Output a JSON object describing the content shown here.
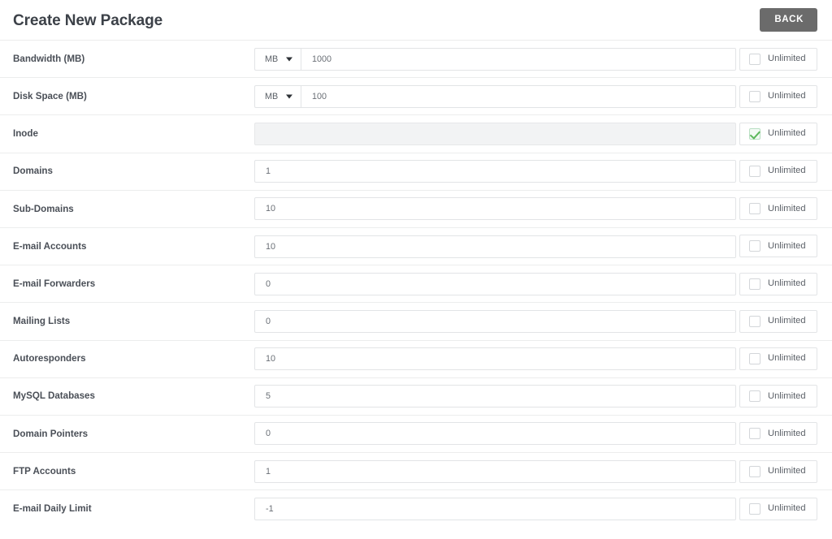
{
  "header": {
    "title": "Create New Package",
    "back_label": "BACK"
  },
  "colors": {
    "back_button_bg": "#6b6b6b",
    "check_green": "#5cb85c",
    "title_text": "#3c4148",
    "row_divider": "#eceded",
    "input_border": "#e2e4e6",
    "disabled_bg": "#f2f3f4"
  },
  "common": {
    "unlimited_label": "Unlimited",
    "caret_icon": "chevron-down-icon",
    "check_icon": "check-icon"
  },
  "rows": [
    {
      "label": "Bandwidth (MB)",
      "unit": "MB",
      "has_unit": true,
      "value": "1000",
      "disabled": false,
      "unlimited": false
    },
    {
      "label": "Disk Space (MB)",
      "unit": "MB",
      "has_unit": true,
      "value": "100",
      "disabled": false,
      "unlimited": false
    },
    {
      "label": "Inode",
      "unit": "",
      "has_unit": false,
      "value": "",
      "disabled": true,
      "unlimited": true
    },
    {
      "label": "Domains",
      "unit": "",
      "has_unit": false,
      "value": "1",
      "disabled": false,
      "unlimited": false
    },
    {
      "label": "Sub-Domains",
      "unit": "",
      "has_unit": false,
      "value": "10",
      "disabled": false,
      "unlimited": false
    },
    {
      "label": "E-mail Accounts",
      "unit": "",
      "has_unit": false,
      "value": "10",
      "disabled": false,
      "unlimited": false
    },
    {
      "label": "E-mail Forwarders",
      "unit": "",
      "has_unit": false,
      "value": "0",
      "disabled": false,
      "unlimited": false
    },
    {
      "label": "Mailing Lists",
      "unit": "",
      "has_unit": false,
      "value": "0",
      "disabled": false,
      "unlimited": false
    },
    {
      "label": "Autoresponders",
      "unit": "",
      "has_unit": false,
      "value": "10",
      "disabled": false,
      "unlimited": false
    },
    {
      "label": "MySQL Databases",
      "unit": "",
      "has_unit": false,
      "value": "5",
      "disabled": false,
      "unlimited": false
    },
    {
      "label": "Domain Pointers",
      "unit": "",
      "has_unit": false,
      "value": "0",
      "disabled": false,
      "unlimited": false
    },
    {
      "label": "FTP Accounts",
      "unit": "",
      "has_unit": false,
      "value": "1",
      "disabled": false,
      "unlimited": false
    },
    {
      "label": "E-mail Daily Limit",
      "unit": "",
      "has_unit": false,
      "value": "-1",
      "disabled": false,
      "unlimited": false
    }
  ]
}
